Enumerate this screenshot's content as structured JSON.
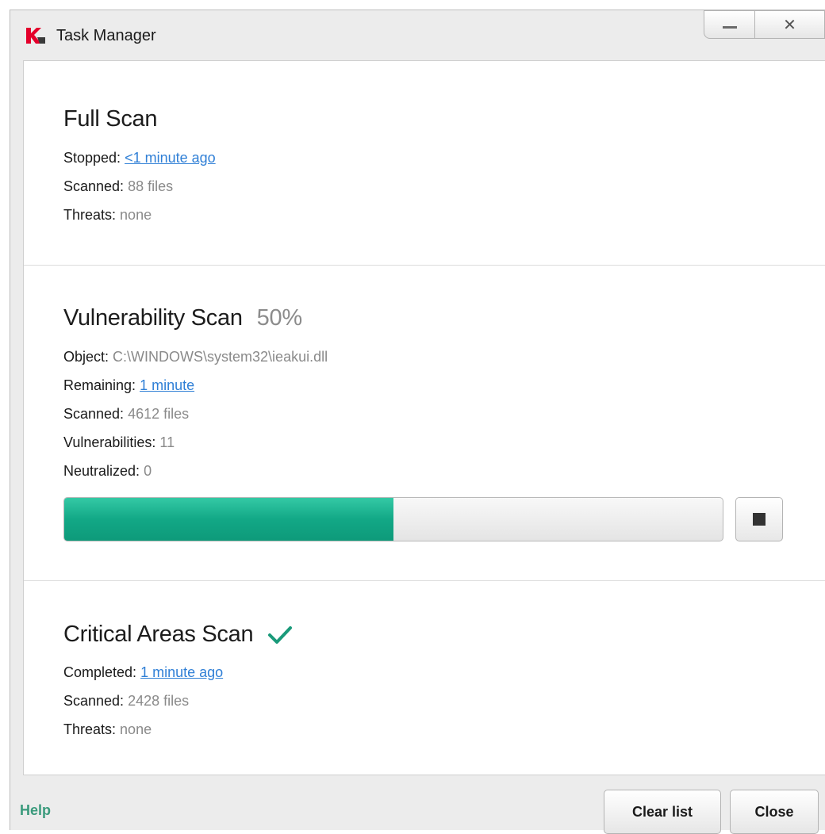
{
  "window": {
    "title": "Task Manager",
    "minimize_icon": "minimize-icon",
    "close_icon": "close-icon",
    "close_glyph": "✕"
  },
  "tasks": [
    {
      "title": "Full Scan",
      "rows": [
        {
          "label": "Stopped:",
          "value": "<1 minute ago",
          "link": true
        },
        {
          "label": "Scanned:",
          "value": "88 files",
          "link": false
        },
        {
          "label": "Threats:",
          "value": "none",
          "link": false
        }
      ]
    },
    {
      "title": "Vulnerability Scan",
      "percent": "50%",
      "progress": 0.5,
      "rows": [
        {
          "label": "Object:",
          "value": "C:\\WINDOWS\\system32\\ieakui.dll",
          "link": false
        },
        {
          "label": "Remaining:",
          "value": "1 minute",
          "link": true
        },
        {
          "label": "Scanned:",
          "value": "4612 files",
          "link": false
        },
        {
          "label": "Vulnerabilities:",
          "value": "11",
          "link": false
        },
        {
          "label": "Neutralized:",
          "value": "0",
          "link": false
        }
      ]
    },
    {
      "title": "Critical Areas Scan",
      "status_icon": "checkmark-icon",
      "rows": [
        {
          "label": "Completed:",
          "value": "1 minute ago",
          "link": true
        },
        {
          "label": "Scanned:",
          "value": "2428 files",
          "link": false
        },
        {
          "label": "Threats:",
          "value": "none",
          "link": false
        }
      ]
    }
  ],
  "footer": {
    "help_label": "Help",
    "clear_label": "Clear list",
    "close_label": "Close"
  },
  "colors": {
    "accent": "#12a886",
    "link": "#2f7fd6",
    "help": "#3a9a7c",
    "checkmark": "#1a9a7a"
  }
}
